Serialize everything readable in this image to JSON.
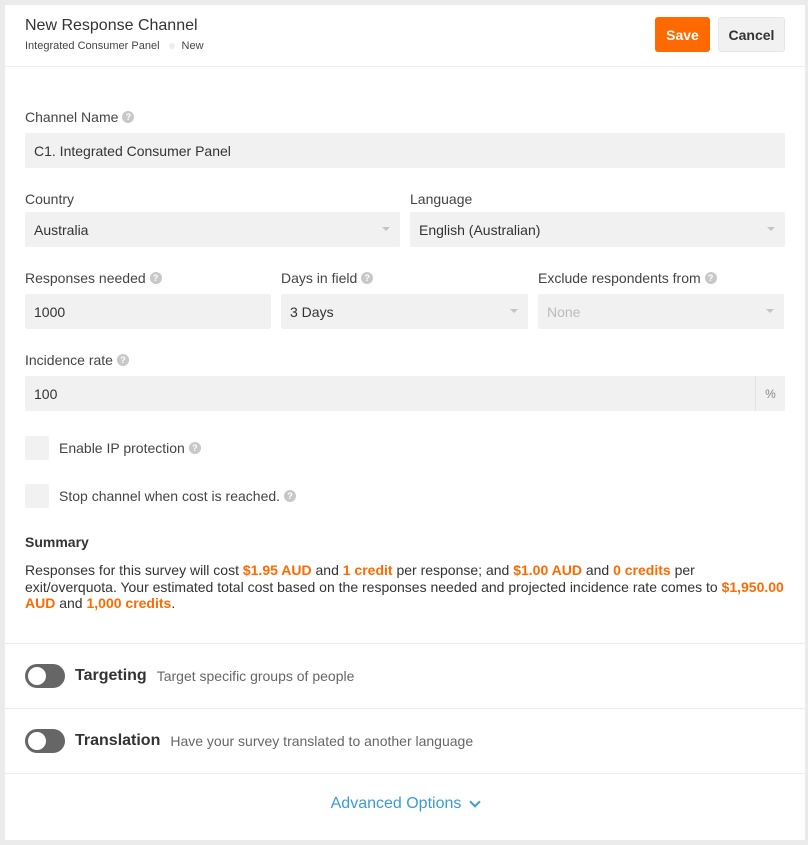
{
  "header": {
    "title": "New Response Channel",
    "breadcrumb": [
      "Integrated Consumer Panel",
      "New"
    ],
    "save_label": "Save",
    "cancel_label": "Cancel"
  },
  "form": {
    "channel_name": {
      "label": "Channel Name",
      "value": "C1. Integrated Consumer Panel"
    },
    "country": {
      "label": "Country",
      "value": "Australia"
    },
    "language": {
      "label": "Language",
      "value": "English (Australian)"
    },
    "responses_needed": {
      "label": "Responses needed",
      "value": "1000"
    },
    "days_in_field": {
      "label": "Days in field",
      "value": "3 Days"
    },
    "exclude": {
      "label": "Exclude respondents from",
      "value": "None"
    },
    "incidence_rate": {
      "label": "Incidence rate",
      "value": "100",
      "suffix": "%"
    },
    "ip_protection": {
      "label": "Enable IP protection",
      "checked": false
    },
    "stop_channel": {
      "label": "Stop channel when cost is reached.",
      "checked": false
    }
  },
  "summary": {
    "title": "Summary",
    "t1": "Responses for this survey will cost ",
    "cost_per_response": "$1.95 AUD",
    "t2": " and ",
    "credits_per_response": "1 credit",
    "t3": " per response; and ",
    "cost_exit": "$1.00 AUD",
    "t4": " and ",
    "credits_exit": "0 credits",
    "t5": " per exit/overquota. Your estimated total cost based on the responses needed and projected incidence rate comes to ",
    "total_cost": "$1,950.00 AUD",
    "t6": " and ",
    "total_credits": "1,000 credits",
    "t7": "."
  },
  "toggles": {
    "targeting": {
      "title": "Targeting",
      "desc": "Target specific groups of people",
      "on": false
    },
    "translation": {
      "title": "Translation",
      "desc": "Have your survey translated to another language",
      "on": false
    }
  },
  "advanced_label": "Advanced Options",
  "colors": {
    "accent": "#ff6a00",
    "link": "#3a9ad9"
  }
}
